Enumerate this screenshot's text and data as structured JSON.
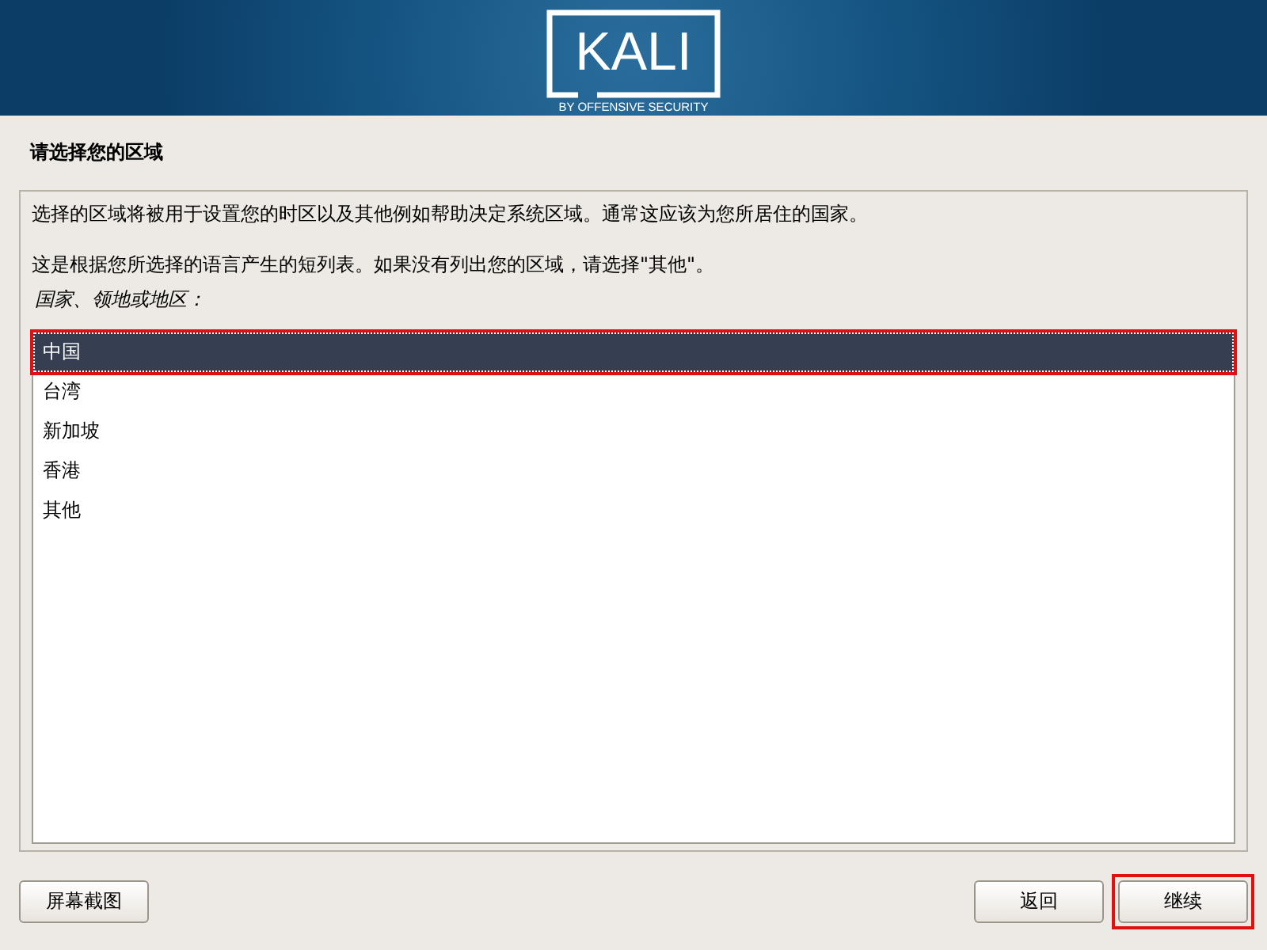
{
  "header": {
    "logo": "KALI",
    "tagline": "BY OFFENSIVE SECURITY"
  },
  "title": "请选择您的区域",
  "description": "选择的区域将被用于设置您的时区以及其他例如帮助决定系统区域。通常这应该为您所居住的国家。",
  "note": "这是根据您所选择的语言产生的短列表。如果没有列出您的区域，请选择\"其他\"。",
  "list_label": "国家、领地或地区：",
  "items": [
    {
      "label": "中国",
      "selected": true
    },
    {
      "label": "台湾",
      "selected": false
    },
    {
      "label": "新加坡",
      "selected": false
    },
    {
      "label": "香港",
      "selected": false
    },
    {
      "label": "其他",
      "selected": false
    }
  ],
  "buttons": [
    {
      "label": "屏幕截图",
      "kind": "left",
      "focused": false
    },
    {
      "label": "返回",
      "kind": "right",
      "focused": false
    },
    {
      "label": "继续",
      "kind": "right",
      "focused": true
    }
  ]
}
